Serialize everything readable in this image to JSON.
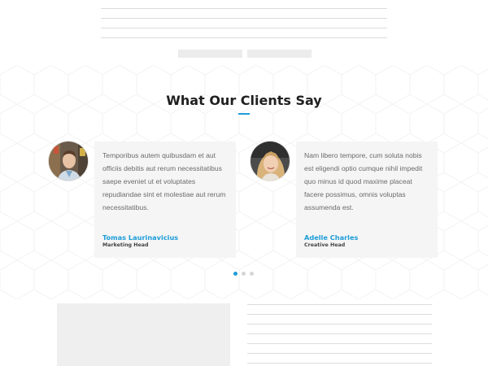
{
  "section": {
    "title": "What Our Clients Say"
  },
  "testimonials": [
    {
      "text": "Temporibus autem quibusdam et aut officiis debitis aut rerum necessitatibus saepe eveniet ut et voluptates repudiandae sint et molestiae aut rerum necessitatibus.",
      "name": "Tomas Laurinavicius",
      "role": "Marketing Head"
    },
    {
      "text": "Nam libero tempore, cum soluta nobis est eligendi optio cumque nihil impedit quo minus id quod maxime placeat facere possimus, omnis voluptas assumenda est.",
      "name": "Adelle Charles",
      "role": "Creative Head"
    }
  ],
  "carousel": {
    "slide_count": 3,
    "active_index": 0
  },
  "colors": {
    "accent": "#1e9dd8",
    "title": "#1f1f1f",
    "card_bg": "#f5f5f5",
    "body_text": "#6b6b6b"
  }
}
